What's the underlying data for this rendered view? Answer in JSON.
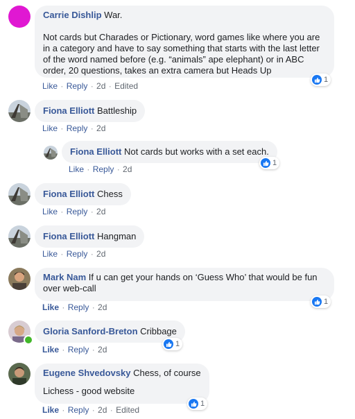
{
  "comments": [
    {
      "author": "Carrie Dishlip",
      "text": "War.",
      "text2": "Not cards but Charades or Pictionary, word games like where you are in a category and have to say something that starts with the last letter of the word named before (e.g. “animals” ape elephant) or in ABC order, 20 questions, takes an extra camera but Heads Up",
      "like": "Like",
      "reply": "Reply",
      "time": "2d",
      "edited": "Edited",
      "reactions": "1"
    },
    {
      "author": "Fiona Elliott",
      "text": "Battleship",
      "like": "Like",
      "reply": "Reply",
      "time": "2d"
    },
    {
      "author": "Fiona Elliott",
      "text": "Not cards but works with a set each.",
      "like": "Like",
      "reply": "Reply",
      "time": "2d",
      "reactions": "1"
    },
    {
      "author": "Fiona Elliott",
      "text": "Chess",
      "like": "Like",
      "reply": "Reply",
      "time": "2d"
    },
    {
      "author": "Fiona Elliott",
      "text": "Hangman",
      "like": "Like",
      "reply": "Reply",
      "time": "2d"
    },
    {
      "author": "Mark Nam",
      "text": "If u can get your hands on ‘Guess Who’ that would be fun over web-call",
      "like": "Like",
      "reply": "Reply",
      "time": "2d",
      "reactions": "1"
    },
    {
      "author": "Gloria Sanford-Breton",
      "text": "Cribbage",
      "like": "Like",
      "reply": "Reply",
      "time": "2d",
      "reactions": "1"
    },
    {
      "author": "Eugene Shvedovsky",
      "text": "Chess, of course",
      "text2": "Lichess - good website",
      "like": "Like",
      "reply": "Reply",
      "time": "2d",
      "edited": "Edited",
      "reactions": "1"
    }
  ],
  "colors": {
    "author": "#385898",
    "bubble": "#f2f3f5",
    "like_icon": "#1877f2",
    "online": "#42b72a"
  },
  "icons": {
    "reaction": "thumbs-up-icon",
    "online": "online-status-icon"
  }
}
